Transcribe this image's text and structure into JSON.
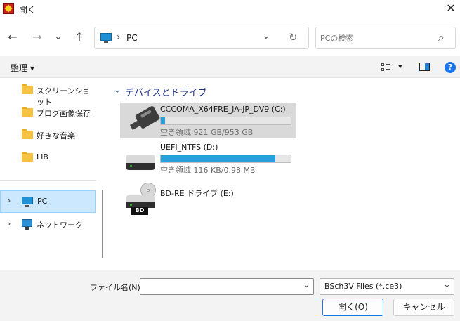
{
  "window": {
    "title": "開く",
    "close_glyph": "✕"
  },
  "nav": {
    "back_glyph": "←",
    "forward_glyph": "→",
    "recent_glyph": "⌄",
    "up_glyph": "↑",
    "address": {
      "separator": "›",
      "location": "PC",
      "dropdown_glyph": "⌄",
      "refresh_glyph": "↻"
    },
    "search": {
      "placeholder": "PCの検索",
      "icon_glyph": "⌕"
    }
  },
  "toolbar": {
    "organize_label": "整理 ▾",
    "view_glyph": "▾",
    "help_label": "?"
  },
  "sidebar": {
    "folders": [
      {
        "label": "スクリーンショット"
      },
      {
        "label": "ブログ画像保存"
      },
      {
        "label": "好きな音楽"
      },
      {
        "label": "LIB"
      }
    ],
    "pc": {
      "label": "PC",
      "chevron": "›"
    },
    "network": {
      "label": "ネットワーク",
      "chevron": "›"
    }
  },
  "content": {
    "group_title": "デバイスとドライブ",
    "group_chevron": "⌄",
    "drives": [
      {
        "name": "CCCOMA_X64FRE_JA-JP_DV9 (C:)",
        "free_text": "空き領域 921 GB/953 GB",
        "used_fraction": 0.03
      },
      {
        "name": "UEFI_NTFS (D:)",
        "free_text": "空き領域 116 KB/0.98 MB",
        "used_fraction": 0.88
      },
      {
        "name": "BD-RE ドライブ (E:)",
        "badge": "BD"
      }
    ]
  },
  "footer": {
    "filename_label": "ファイル名(N):",
    "filename_value": "",
    "dropdown_glyph": "⌄",
    "filter_value": "BSch3V Files (*.ce3)",
    "open_label": "開く(O)",
    "cancel_label": "キャンセル"
  },
  "colors": {
    "accent": "#26a0da",
    "selection": "#cce8ff",
    "help_blue": "#1a73e8"
  }
}
